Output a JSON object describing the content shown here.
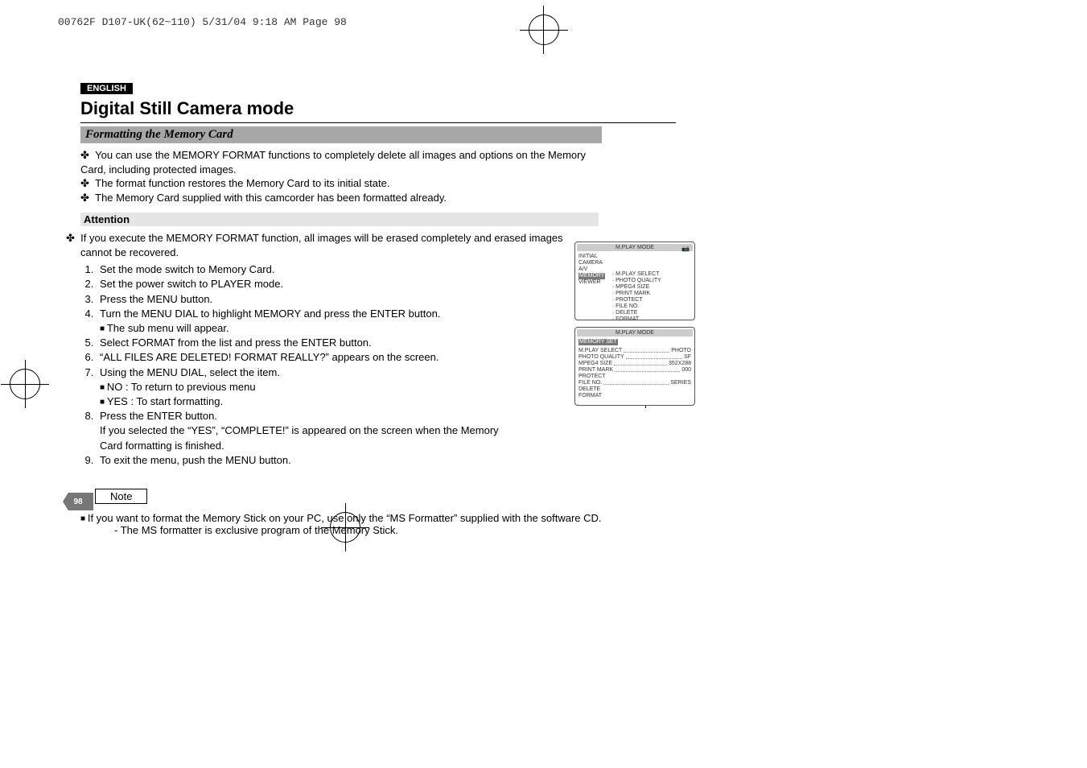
{
  "header_line": "00762F D107-UK(62~110)  5/31/04 9:18 AM  Page 98",
  "lang_badge": "ENGLISH",
  "title": "Digital Still Camera mode",
  "subtitle": "Formatting the Memory Card",
  "intro": [
    "You can use the MEMORY FORMAT functions to completely delete all images and options on the Memory Card, including protected images.",
    "The format function restores the Memory Card to its initial state.",
    "The Memory Card supplied with this camcorder has been formatted already."
  ],
  "attention_label": "Attention",
  "attention_text": "If you execute the MEMORY FORMAT function, all images will be erased completely and erased images cannot be recovered.",
  "steps": [
    {
      "text": "Set the mode switch to Memory Card."
    },
    {
      "text": "Set the power switch to PLAYER mode."
    },
    {
      "text": "Press the MENU button."
    },
    {
      "text": "Turn the MENU DIAL to highlight MEMORY and press the ENTER button.",
      "subs": [
        "The sub menu will appear."
      ]
    },
    {
      "text": "Select FORMAT from the list and press the ENTER button."
    },
    {
      "text": "“ALL FILES ARE DELETED! FORMAT REALLY?” appears on the screen."
    },
    {
      "text": "Using the MENU DIAL, select the item.",
      "subs": [
        "NO : To return to previous menu",
        "YES : To start formatting."
      ]
    },
    {
      "text": "Press the ENTER button.",
      "cont": "If you selected the “YES”, “COMPLETE!” is appeared on the screen when the Memory Card formatting is finished."
    },
    {
      "text": "To exit the menu, push the MENU button."
    }
  ],
  "note_label": "Note",
  "note_main": "If you want to format the Memory Stick on your PC, use only the “MS Formatter” supplied with the software CD.",
  "note_sub": "-   The MS formatter is exclusive program of the Memory Stick.",
  "page_number": "98",
  "osd1": {
    "title": "M.PLAY  MODE",
    "left": [
      "INITIAL",
      "CAMERA",
      "A/V",
      "MEMORY",
      "VIEWER"
    ],
    "right": [
      "M.PLAY SELECT",
      "PHOTO QUALITY",
      "MPEG4 SIZE",
      "PRINT MARK",
      "PROTECT",
      "FILE NO.",
      "DELETE",
      "FORMAT"
    ]
  },
  "osd2": {
    "title": "M.PLAY  MODE",
    "heading": "MEMORY SET",
    "rows": [
      {
        "l": "M.PLAY SELECT",
        "r": "PHOTO"
      },
      {
        "l": "PHOTO QUALITY",
        "r": "SF"
      },
      {
        "l": "MPEG4 SIZE",
        "r": "352X288"
      },
      {
        "l": "PRINT MARK",
        "r": "000"
      },
      {
        "l": "PROTECT",
        "r": ""
      },
      {
        "l": "FILE NO.",
        "r": "SERIES"
      },
      {
        "l": "DELETE",
        "r": ""
      },
      {
        "l": "FORMAT",
        "r": ""
      }
    ]
  }
}
